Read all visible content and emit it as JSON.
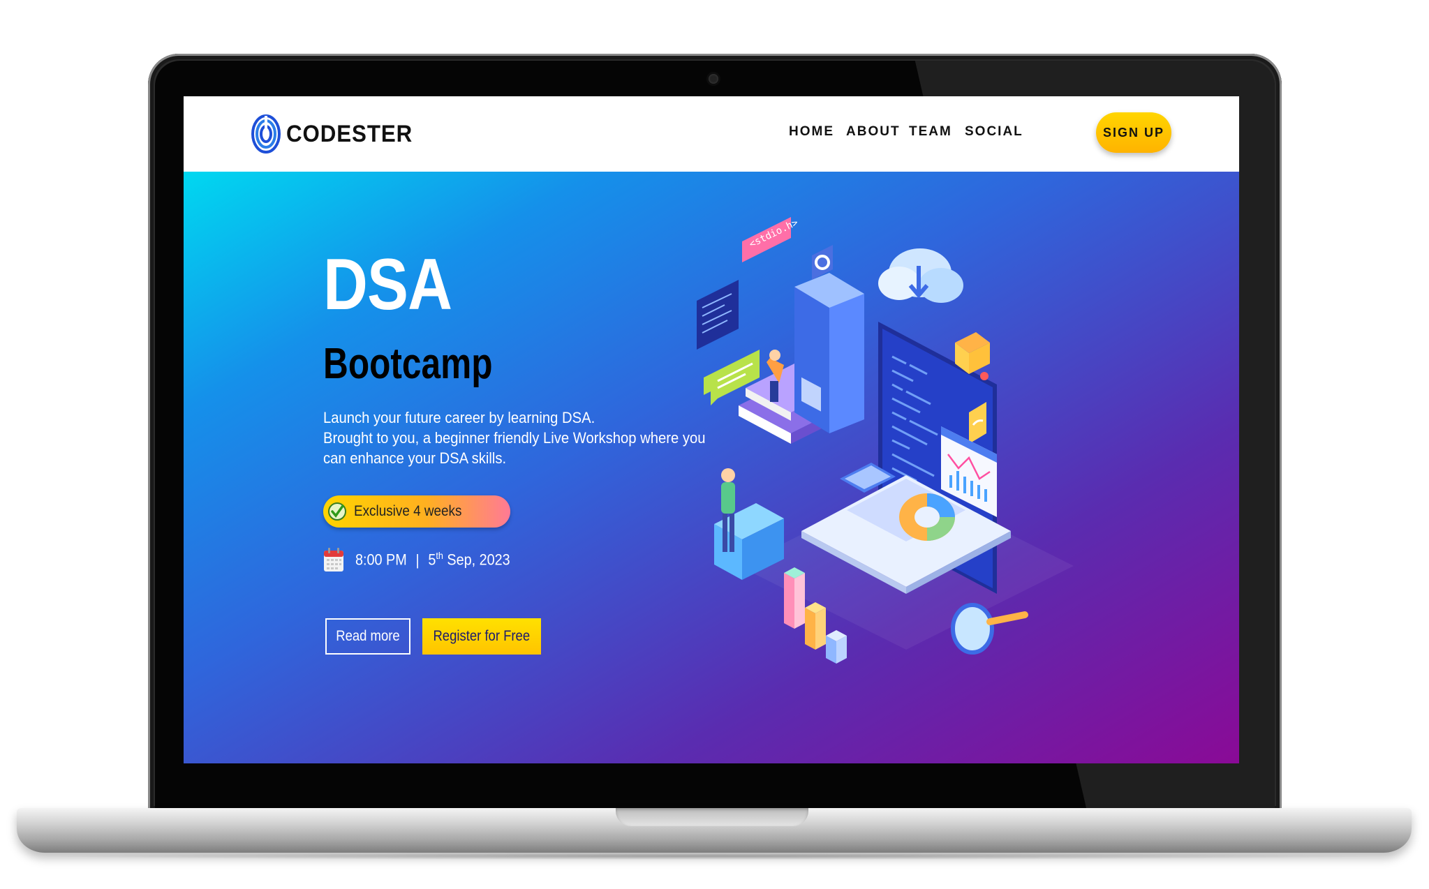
{
  "brand": {
    "name": "CODESTER"
  },
  "nav": {
    "items": [
      {
        "label": "HOME"
      },
      {
        "label": "ABOUT"
      },
      {
        "label": "TEAM"
      },
      {
        "label": "SOCIAL"
      }
    ],
    "signup_label": "SIGN UP"
  },
  "hero": {
    "title": "DSA",
    "subtitle": "Bootcamp",
    "description": [
      "Launch your future career by learning DSA.",
      "Brought to you, a beginner friendly Live Workshop where you",
      "can enhance your DSA skills."
    ],
    "badge": "Exclusive 4 weeks",
    "time": "8:00 PM",
    "separator": "|",
    "day": "5",
    "day_suffix": "th",
    "month_year": "Sep, 2023",
    "read_more_label": "Read more",
    "register_label": "Register for Free",
    "illustration_code_tag": "<stdio.h>"
  },
  "colors": {
    "accent_yellow": "#ffc400",
    "hero_gradient_start": "#00d8f0",
    "hero_gradient_end": "#8a0a96"
  }
}
